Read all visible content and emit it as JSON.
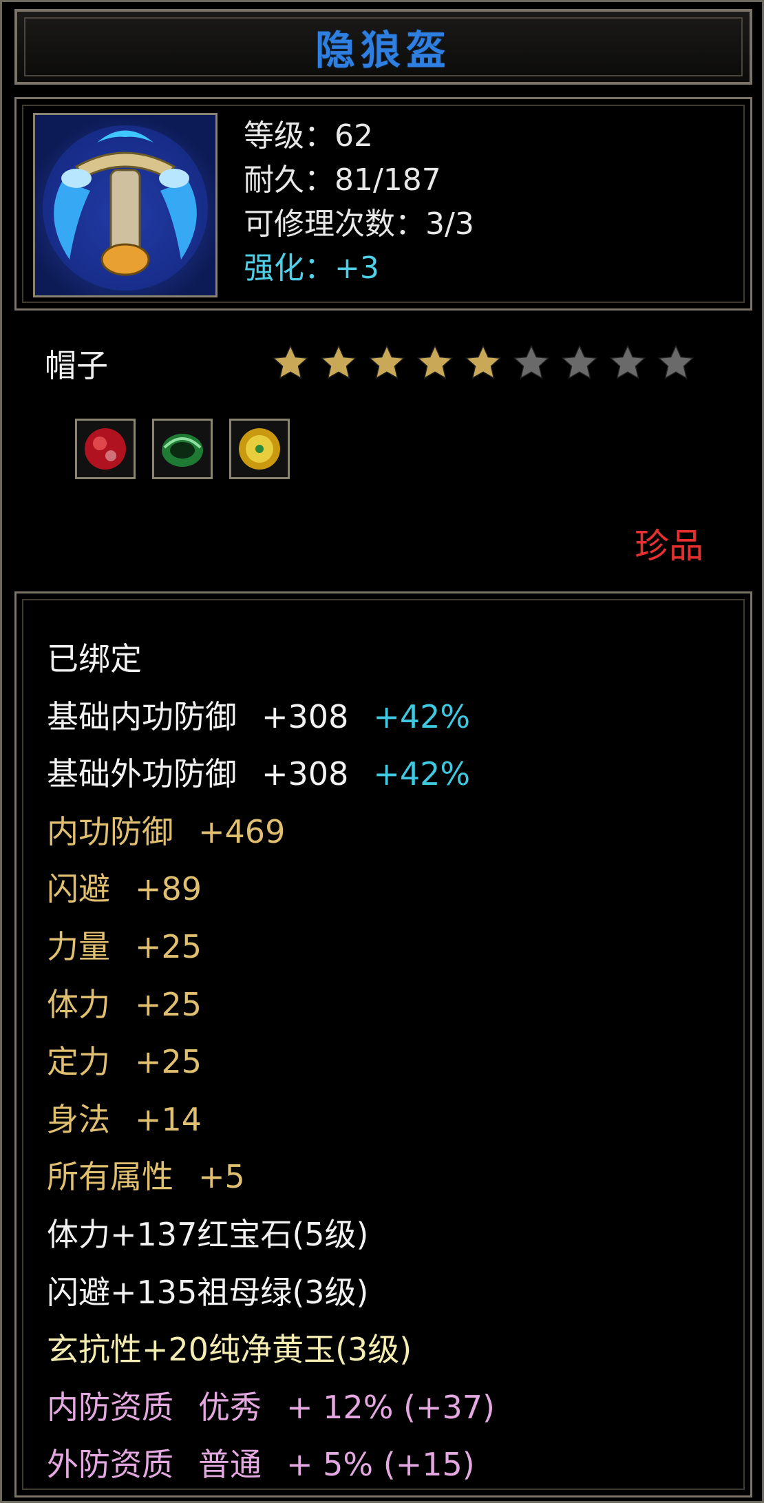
{
  "item": {
    "name": "隐狼盔",
    "stats": {
      "level": "等级：62",
      "durability": "耐久：81/187",
      "repairs": "可修理次数：3/3",
      "enhance": "强化：+3"
    },
    "type": "帽子",
    "stars": {
      "total": 9,
      "filled": 5,
      "filled_color": "#c9a857",
      "empty_color": "#6a6a6a"
    },
    "gems": [
      {
        "name": "ruby-gem-icon",
        "color": "#d11a2a"
      },
      {
        "name": "emerald-gem-icon",
        "color": "#2f9a4a"
      },
      {
        "name": "topaz-gem-icon",
        "color": "#d8b22a"
      }
    ],
    "rarity": "珍品"
  },
  "attributes": {
    "bound": "已绑定",
    "base_inner_def": {
      "label": "基础内功防御",
      "value": "+308",
      "bonus": "+42%"
    },
    "base_outer_def": {
      "label": "基础外功防御",
      "value": "+308",
      "bonus": "+42%"
    },
    "inner_def": {
      "label": "内功防御",
      "value": "+469"
    },
    "dodge": {
      "label": "闪避",
      "value": "+89"
    },
    "strength": {
      "label": "力量",
      "value": "+25"
    },
    "stamina": {
      "label": "体力",
      "value": "+25"
    },
    "focus": {
      "label": "定力",
      "value": "+25"
    },
    "agility": {
      "label": "身法",
      "value": "+14"
    },
    "all_attr": {
      "label": "所有属性",
      "value": "+5"
    },
    "gem1": "体力+137红宝石(5级)",
    "gem2": "闪避+135祖母绿(3级)",
    "gem3": "玄抗性+20纯净黄玉(3级)",
    "q_inner": {
      "label": "内防资质",
      "grade": "优秀",
      "detail": "+ 12% (+37)"
    },
    "q_outer": {
      "label": "外防资质",
      "grade": "普通",
      "detail": "+ 5% (+15)"
    }
  }
}
